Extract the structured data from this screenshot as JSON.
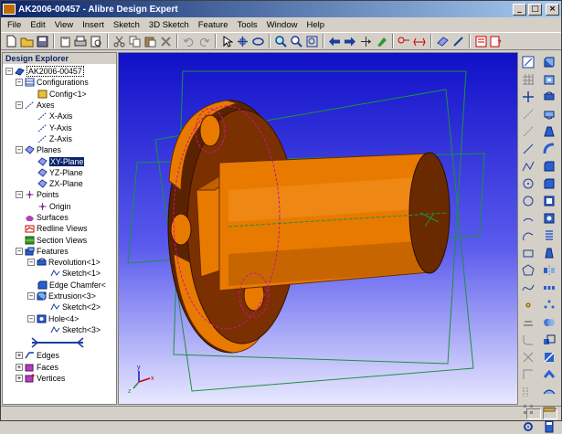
{
  "window": {
    "title": "AK2006-00457 - Alibre Design Expert"
  },
  "titlebar_buttons": {
    "minimize": "_",
    "maximize": "□",
    "close": "×"
  },
  "menu": [
    "File",
    "Edit",
    "View",
    "Insert",
    "Sketch",
    "3D Sketch",
    "Feature",
    "Tools",
    "Window",
    "Help"
  ],
  "panel": {
    "title": "Design Explorer"
  },
  "tree": {
    "root": "AK2006-00457",
    "configurations": "Configurations",
    "config1": "Config<1>",
    "axes": "Axes",
    "x_axis": "X-Axis",
    "y_axis": "Y-Axis",
    "z_axis": "Z-Axis",
    "planes": "Planes",
    "xy_plane": "XY-Plane",
    "yz_plane": "YZ-Plane",
    "zx_plane": "ZX-Plane",
    "points": "Points",
    "origin": "Origin",
    "surfaces": "Surfaces",
    "redline_views": "Redline Views",
    "section_views": "Section Views",
    "features": "Features",
    "revolution": "Revolution<1>",
    "sketch1": "Sketch<1>",
    "edge_chamfer": "Edge Chamfer<",
    "extrusion": "Extrusion<3>",
    "sketch2": "Sketch<2>",
    "hole": "Hole<4>",
    "sketch3": "Sketch<3>",
    "edges": "Edges",
    "faces": "Faces",
    "vertices": "Vertices"
  },
  "triad": {
    "x": "x",
    "y": "y",
    "z": "z"
  },
  "colors": {
    "part": "#e87a00",
    "part_dark": "#6a2a00",
    "planes": "#1e9040",
    "sketch": "#d01090",
    "bg_top": "#1010c8"
  },
  "icons": {
    "toolbar": [
      "new-icon",
      "open-icon",
      "save-icon",
      "properties-icon",
      "print-icon",
      "cut-icon",
      "copy-icon",
      "paste-icon",
      "undo-icon",
      "redo-icon",
      "select-icon",
      "pan-icon",
      "rotate-icon",
      "zoom-icon",
      "zoom-window-icon",
      "zoom-fit-icon",
      "back-icon",
      "forward-icon",
      "move-icon",
      "sketch-icon",
      "dimension-icon",
      "plane-icon",
      "feature-icon",
      "drawing-icon",
      "help-icon"
    ]
  }
}
